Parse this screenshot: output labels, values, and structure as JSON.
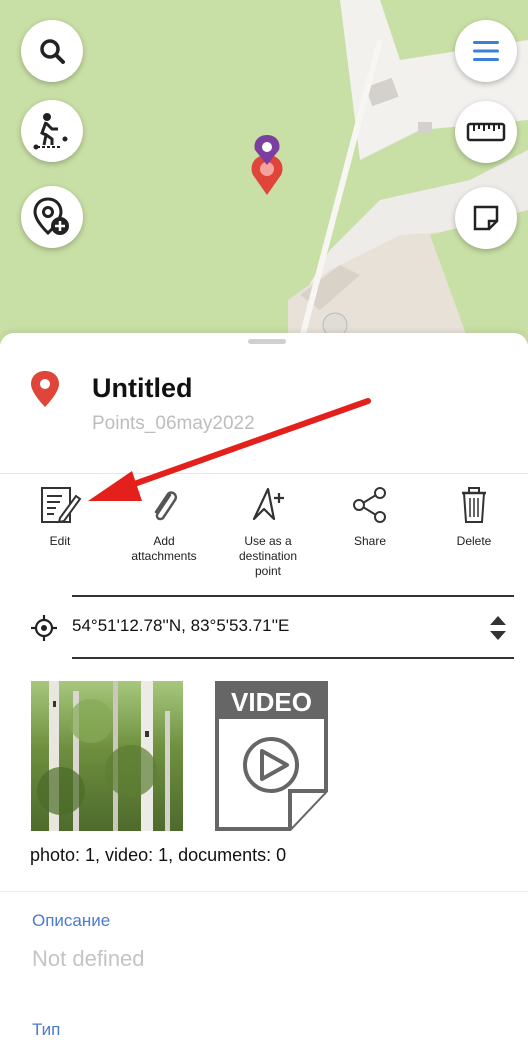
{
  "map": {
    "buttons": [
      "search-icon",
      "walking-route-icon",
      "add-point-icon",
      "menu-icon",
      "ruler-icon",
      "map-layers-icon"
    ],
    "colors": {
      "park": "#c8dfa5",
      "pin_red": "#e0453a",
      "pin_purple": "#7b3fa0",
      "accent": "#3b82d6"
    }
  },
  "point": {
    "title": "Untitled",
    "folder": "Points_06may2022"
  },
  "actions": [
    {
      "label": "Edit"
    },
    {
      "label": "Add attachments"
    },
    {
      "label": "Use as a destination point"
    },
    {
      "label": "Share"
    },
    {
      "label": "Delete"
    }
  ],
  "coordinates": "54°51'12.78''N, 83°5'53.71''E",
  "attachments": {
    "video_label": "VIDEO",
    "summary": "photo: 1, video: 1, documents: 0"
  },
  "fields": [
    {
      "label": "Описание",
      "value": "Not defined"
    },
    {
      "label": "Тип"
    }
  ]
}
